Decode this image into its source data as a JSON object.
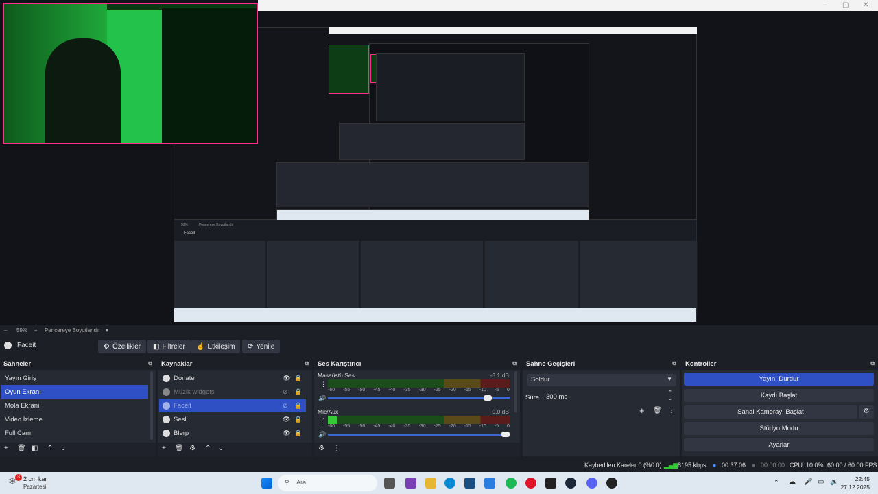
{
  "preview": {
    "mini_toolbar": {
      "source_name": "Faceit",
      "buttons": [
        "Özellikler",
        "Filtreler",
        "Etkileşim",
        "Yenile"
      ]
    },
    "mini_zoom": "59%",
    "mini_fit": "Pencereye Boyutlandır"
  },
  "zoom": {
    "level": "59%",
    "fit_label": "Pencereye Boyutlandır"
  },
  "toolbar": {
    "source_name": "Faceit",
    "properties": "Özellikler",
    "filters": "Filtreler",
    "interact": "Etkileşim",
    "refresh": "Yenile"
  },
  "scenes": {
    "title": "Sahneler",
    "items": [
      "Yayın Giriş",
      "Oyun Ekranı",
      "Mola Ekranı",
      "Video İzleme",
      "Full Cam"
    ],
    "selected_index": 1
  },
  "sources": {
    "title": "Kaynaklar",
    "items": [
      {
        "name": "Donate",
        "visible": true,
        "dim": false,
        "selected": false
      },
      {
        "name": "Müzik widgets",
        "visible": false,
        "dim": true,
        "selected": false
      },
      {
        "name": "Faceit",
        "visible": false,
        "dim": true,
        "selected": true
      },
      {
        "name": "Sesli",
        "visible": true,
        "dim": false,
        "selected": false
      },
      {
        "name": "Blerp",
        "visible": true,
        "dim": false,
        "selected": false
      }
    ]
  },
  "mixer": {
    "title": "Ses Karıştırıcı",
    "scale": [
      "-60",
      "-55",
      "-50",
      "-45",
      "-40",
      "-35",
      "-30",
      "-25",
      "-20",
      "-15",
      "-10",
      "-5",
      "0"
    ],
    "channels": [
      {
        "name": "Masaüstü Ses",
        "db": "-3.1 dB",
        "level": 0.0,
        "volume": 0.9
      },
      {
        "name": "Mic/Aux",
        "db": "0.0 dB",
        "level": 0.05,
        "volume": 1.0
      }
    ]
  },
  "transitions": {
    "title": "Sahne Geçişleri",
    "selected": "Soldur",
    "duration_label": "Süre",
    "duration_value": "300 ms"
  },
  "controls": {
    "title": "Kontroller",
    "stop_stream": "Yayını Durdur",
    "start_recording": "Kaydı Başlat",
    "start_vcam": "Sanal Kamerayı Başlat",
    "studio_mode": "Stüdyo Modu",
    "settings": "Ayarlar"
  },
  "status": {
    "dropped": "Kaybedilen Kareler 0 (%0.0)",
    "bitrate": "8195 kbps",
    "stream_time": "00:37:06",
    "rec_time": "00:00:00",
    "cpu": "CPU: 10.0%",
    "fps": "60.00 / 60.00 FPS"
  },
  "taskbar": {
    "weather_temp": "2 cm kar",
    "weather_day": "Pazartesi",
    "weather_badge": "3",
    "search_placeholder": "Ara",
    "time": "22:45",
    "date": "27.12.2025"
  },
  "colors": {
    "accent": "#2f4fc4",
    "cam_border": "#ff2d8c",
    "meter_green": "#35c935",
    "panel": "#262a33",
    "bg": "#1d1f26"
  }
}
